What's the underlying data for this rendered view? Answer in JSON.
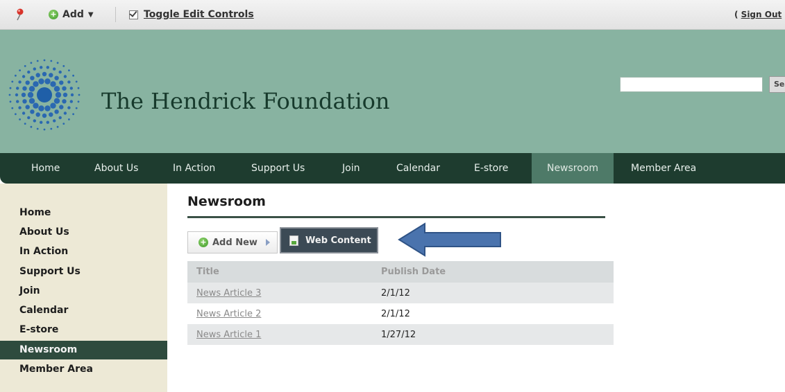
{
  "topbar": {
    "add_label": "Add",
    "toggle_label": "Toggle Edit Controls",
    "signout_prefix": "( ",
    "signout_label": "Sign Out"
  },
  "header": {
    "site_title": "The Hendrick Foundation",
    "search_placeholder": "",
    "search_button": "Se"
  },
  "nav": {
    "items": [
      "Home",
      "About Us",
      "In Action",
      "Support Us",
      "Join",
      "Calendar",
      "E-store",
      "Newsroom",
      "Member Area"
    ],
    "active": "Newsroom"
  },
  "sidebar": {
    "items": [
      "Home",
      "About Us",
      "In Action",
      "Support Us",
      "Join",
      "Calendar",
      "E-store",
      "Newsroom",
      "Member Area"
    ],
    "active": "Newsroom"
  },
  "content": {
    "heading": "Newsroom",
    "add_new_label": "Add New",
    "web_content_label": "Web Content"
  },
  "table": {
    "columns": [
      "Title",
      "Publish Date"
    ],
    "rows": [
      {
        "title": "News Article 3",
        "date": "2/1/12"
      },
      {
        "title": "News Article 2",
        "date": "2/1/12"
      },
      {
        "title": "News Article 1",
        "date": "1/27/12"
      }
    ]
  },
  "colors": {
    "header_bg": "#88b3a1",
    "nav_bg": "#1e3c2f",
    "nav_active": "#4e7a68",
    "sidebar_bg": "#ede9d6",
    "arrow": "#4a73ad"
  }
}
